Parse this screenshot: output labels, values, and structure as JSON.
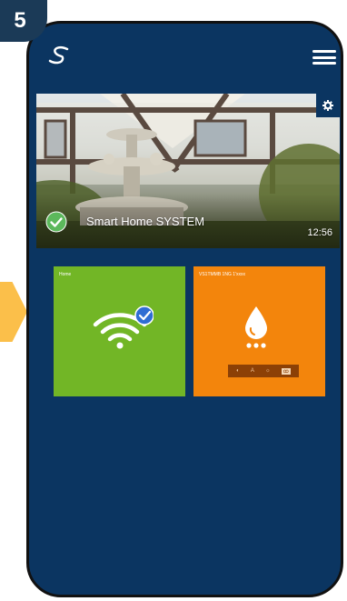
{
  "step": "5",
  "colors": {
    "app_bg": "#0b3561",
    "home_tile": "#72b626",
    "device_tile": "#f3850c",
    "arrow": "#fbbf4a"
  },
  "header": {
    "logo_icon": "s-logo-icon",
    "menu_icon": "hamburger-menu-icon"
  },
  "banner": {
    "title": "Smart Home SYSTEM",
    "time": "12:56",
    "status_icon": "check-circle-icon",
    "settings_icon": "gear-icon"
  },
  "tiles": [
    {
      "label": "Home",
      "icon": "wifi-check-icon"
    },
    {
      "label": "VS1TMMB 1NG 1'xxxx",
      "icon": "water-drop-icon",
      "modes": [
        "◐",
        "A",
        "☼",
        "ꝏ"
      ]
    }
  ]
}
